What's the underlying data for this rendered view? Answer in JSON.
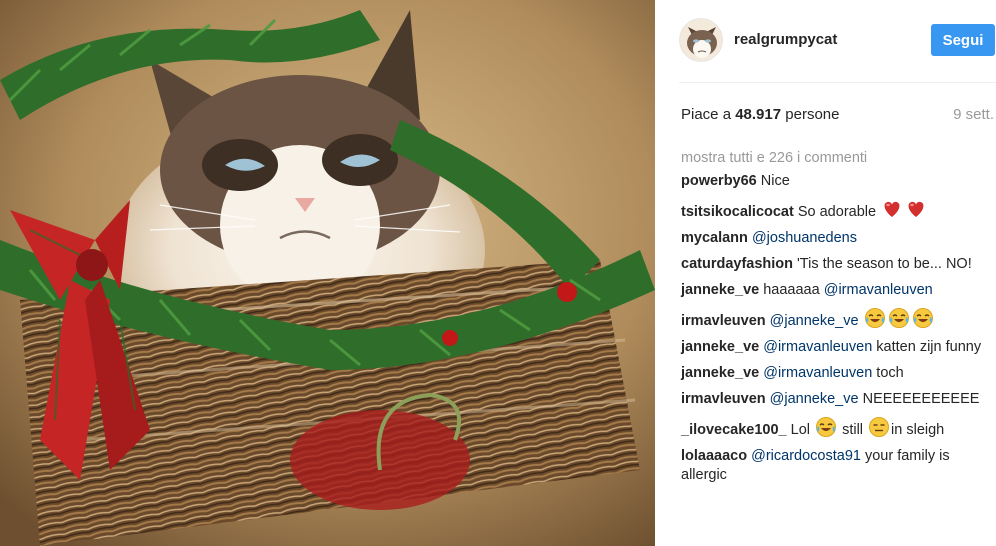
{
  "post": {
    "username": "realgrumpycat",
    "follow_label": "Segui",
    "likes_prefix": "Piace a ",
    "likes_count": "48.917",
    "likes_suffix": " persone",
    "timestamp": "9 sett.",
    "show_all_comments": "mostra tutti e 226 i commenti"
  },
  "comments": [
    {
      "user": "powerby66",
      "parts": [
        {
          "t": "text",
          "v": " Nice"
        }
      ]
    },
    {
      "user": "tsitsikocalicocat",
      "parts": [
        {
          "t": "text",
          "v": " So adorable "
        },
        {
          "t": "emoji",
          "v": "heart"
        },
        {
          "t": "emoji",
          "v": "heart"
        }
      ]
    },
    {
      "user": "mycalann",
      "parts": [
        {
          "t": "text",
          "v": " "
        },
        {
          "t": "mention",
          "v": "@joshuanedens"
        }
      ]
    },
    {
      "user": "caturdayfashion",
      "parts": [
        {
          "t": "text",
          "v": " 'Tis the season to be... NO!"
        }
      ]
    },
    {
      "user": "janneke_ve",
      "parts": [
        {
          "t": "text",
          "v": " haaaaaa "
        },
        {
          "t": "mention",
          "v": "@irmavanleuven"
        }
      ]
    },
    {
      "user": "irmavleuven",
      "parts": [
        {
          "t": "text",
          "v": " "
        },
        {
          "t": "mention",
          "v": "@janneke_ve"
        },
        {
          "t": "text",
          "v": " "
        },
        {
          "t": "emoji",
          "v": "joy"
        },
        {
          "t": "emoji",
          "v": "joy"
        },
        {
          "t": "emoji",
          "v": "joy"
        }
      ]
    },
    {
      "user": "janneke_ve",
      "parts": [
        {
          "t": "text",
          "v": " "
        },
        {
          "t": "mention",
          "v": "@irmavanleuven"
        },
        {
          "t": "text",
          "v": " katten zijn funny"
        }
      ]
    },
    {
      "user": "janneke_ve",
      "parts": [
        {
          "t": "text",
          "v": " "
        },
        {
          "t": "mention",
          "v": "@irmavanleuven"
        },
        {
          "t": "text",
          "v": " toch"
        }
      ]
    },
    {
      "user": "irmavleuven",
      "parts": [
        {
          "t": "text",
          "v": " "
        },
        {
          "t": "mention",
          "v": "@janneke_ve"
        },
        {
          "t": "text",
          "v": " NEEEEEEEEEEE"
        }
      ]
    },
    {
      "user": "_ilovecake100_",
      "parts": [
        {
          "t": "text",
          "v": " Lol "
        },
        {
          "t": "emoji",
          "v": "joy"
        },
        {
          "t": "text",
          "v": " still "
        },
        {
          "t": "emoji",
          "v": "expressionless"
        },
        {
          "t": "text",
          "v": "in sleigh"
        }
      ]
    },
    {
      "user": "lolaaaaco",
      "parts": [
        {
          "t": "text",
          "v": " "
        },
        {
          "t": "mention",
          "v": "@ricardocosta91"
        },
        {
          "t": "text",
          "v": " your family is allergic"
        }
      ]
    }
  ],
  "icons": {
    "heart": "heart-emoji",
    "joy": "tears-of-joy-emoji",
    "expressionless": "expressionless-emoji"
  },
  "colors": {
    "accent": "#3897f0",
    "mention": "#003569",
    "muted": "#999999",
    "heart": "#d32f2f"
  }
}
